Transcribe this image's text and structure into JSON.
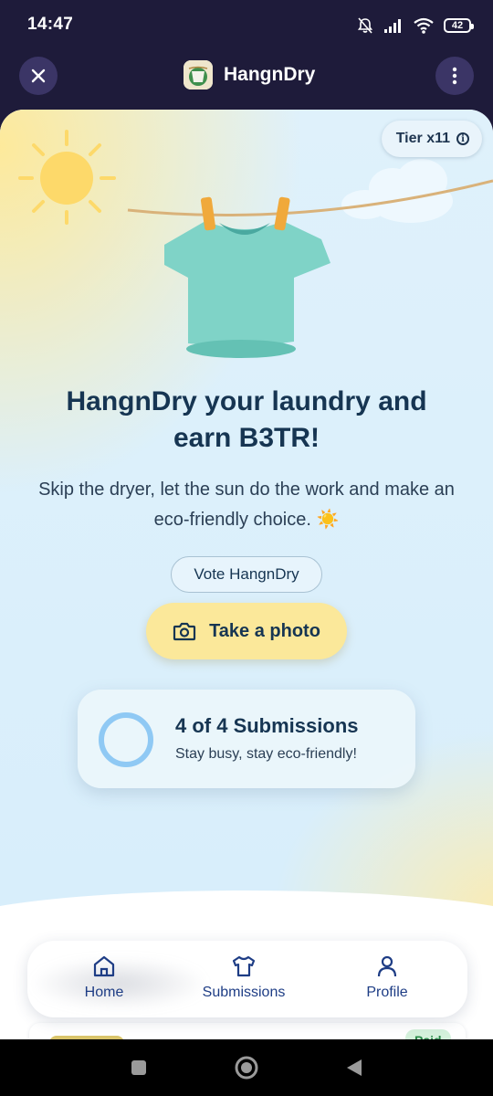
{
  "status_bar": {
    "time": "14:47",
    "battery": "42"
  },
  "header": {
    "title": "HangnDry",
    "close_icon": "close-icon",
    "menu_icon": "more-vertical-icon"
  },
  "hero": {
    "tier_label": "Tier x11",
    "headline": "HangnDry your laundry and earn B3TR!",
    "subtext": "Skip the dryer, let the sun do the work and make an eco-friendly choice. ☀️",
    "vote_label": "Vote HangnDry",
    "photo_label": "Take a photo"
  },
  "submissions_card": {
    "title": "4 of 4 Submissions",
    "subtitle": "Stay busy, stay eco-friendly!",
    "progress_fraction": 1
  },
  "bottom_nav": {
    "items": [
      {
        "label": "Home",
        "icon": "home-icon"
      },
      {
        "label": "Submissions",
        "icon": "shirt-icon"
      },
      {
        "label": "Profile",
        "icon": "person-icon"
      }
    ]
  },
  "peek_card": {
    "badge": "Paid"
  },
  "colors": {
    "header_bg": "#1e1b3a",
    "accent_yellow": "#fbe89a",
    "text_navy": "#163552",
    "nav_blue": "#1e3d85",
    "ring_blue": "#8fc9f4"
  }
}
